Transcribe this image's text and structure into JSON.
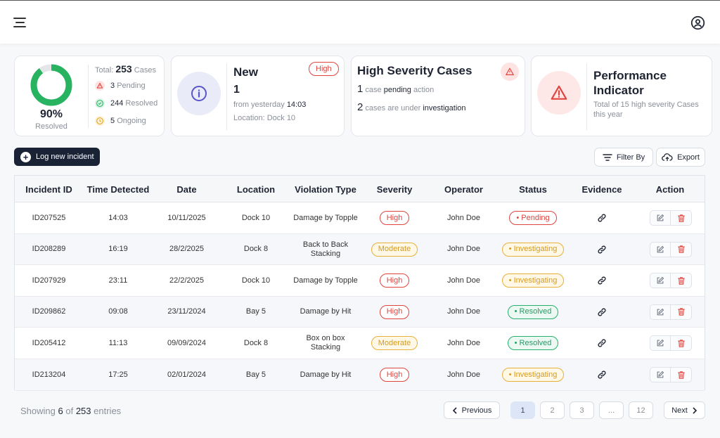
{
  "header": {
    "menu_icon": "hamburger-menu-icon",
    "user_icon": "user-circle-icon"
  },
  "summary": {
    "percent": "90%",
    "percent_label": "Resolved",
    "percent_value": 0.9,
    "total_prefix": "Total:",
    "total_value": "253",
    "total_suffix": "Cases",
    "pending_count": "3",
    "pending_label": "Pending",
    "resolved_count": "244",
    "resolved_label": "Resolved",
    "ongoing_count": "5",
    "ongoing_label": "Ongoing"
  },
  "new_card": {
    "title": "New",
    "badge": "High",
    "count": "1",
    "from_prefix": "from yesterday",
    "from_time": "14:03",
    "location": "Location: Dock 10"
  },
  "severity_card": {
    "title": "High Severity Cases",
    "line1_num": "1",
    "line1_a": "case",
    "line1_b": "pending",
    "line1_c": "action",
    "line2_num": "2",
    "line2_a": "cases are under",
    "line2_b": "investigation"
  },
  "performance_card": {
    "title_line1": "Performance",
    "title_line2": "Indicator",
    "desc_line1": "Total of 15 high severity Cases",
    "desc_line2": "this year"
  },
  "toolbar": {
    "log_label": "Log new incident",
    "filter_label": "Filter By",
    "export_label": "Export"
  },
  "table": {
    "headers": [
      "Incident ID",
      "Time Detected",
      "Date",
      "Location",
      "Violation Type",
      "Severity",
      "Operator",
      "Status",
      "Evidence",
      "Action"
    ],
    "rows": [
      {
        "id": "ID207525",
        "time": "14:03",
        "date": "10/11/2025",
        "location": "Dock 10",
        "violation": "Damage by Topple",
        "severity": "High",
        "operator": "John Doe",
        "status": "• Pending"
      },
      {
        "id": "ID208289",
        "time": "16:19",
        "date": "28/2/2025",
        "location": "Dock 8",
        "violation": "Back to Back Stacking",
        "severity": "Moderate",
        "operator": "John Doe",
        "status": "• Investigating"
      },
      {
        "id": "ID207929",
        "time": "23:11",
        "date": "22/2/2025",
        "location": "Dock 10",
        "violation": "Damage by Topple",
        "severity": "High",
        "operator": "John Doe",
        "status": "• Investigating"
      },
      {
        "id": "ID209862",
        "time": "09:08",
        "date": "23/11/2024",
        "location": "Bay 5",
        "violation": "Damage by Hit",
        "severity": "High",
        "operator": "John Doe",
        "status": "• Resolved"
      },
      {
        "id": "ID205412",
        "time": "11:13",
        "date": "09/09/2024",
        "location": "Dock 8",
        "violation": "Box on box Stacking",
        "severity": "Moderate",
        "operator": "John Doe",
        "status": "• Resolved"
      },
      {
        "id": "ID213204",
        "time": "17:25",
        "date": "02/01/2024",
        "location": "Bay 5",
        "violation": "Damage by Hit",
        "severity": "High",
        "operator": "John Doe",
        "status": "• Investigating"
      }
    ]
  },
  "footer": {
    "showing_prefix": "Showing",
    "showing_count": "6",
    "showing_of": "of",
    "showing_total": "253",
    "showing_suffix": "entries",
    "previous": "Previous",
    "next": "Next",
    "pages": [
      "1",
      "2",
      "3",
      "...",
      "12"
    ]
  },
  "colors": {
    "accent": "#1a2236",
    "resolved_green": "#27b35f",
    "danger_red": "#e0443e",
    "warning_amber": "#e6b03b",
    "info_blue": "#5a55c8"
  }
}
